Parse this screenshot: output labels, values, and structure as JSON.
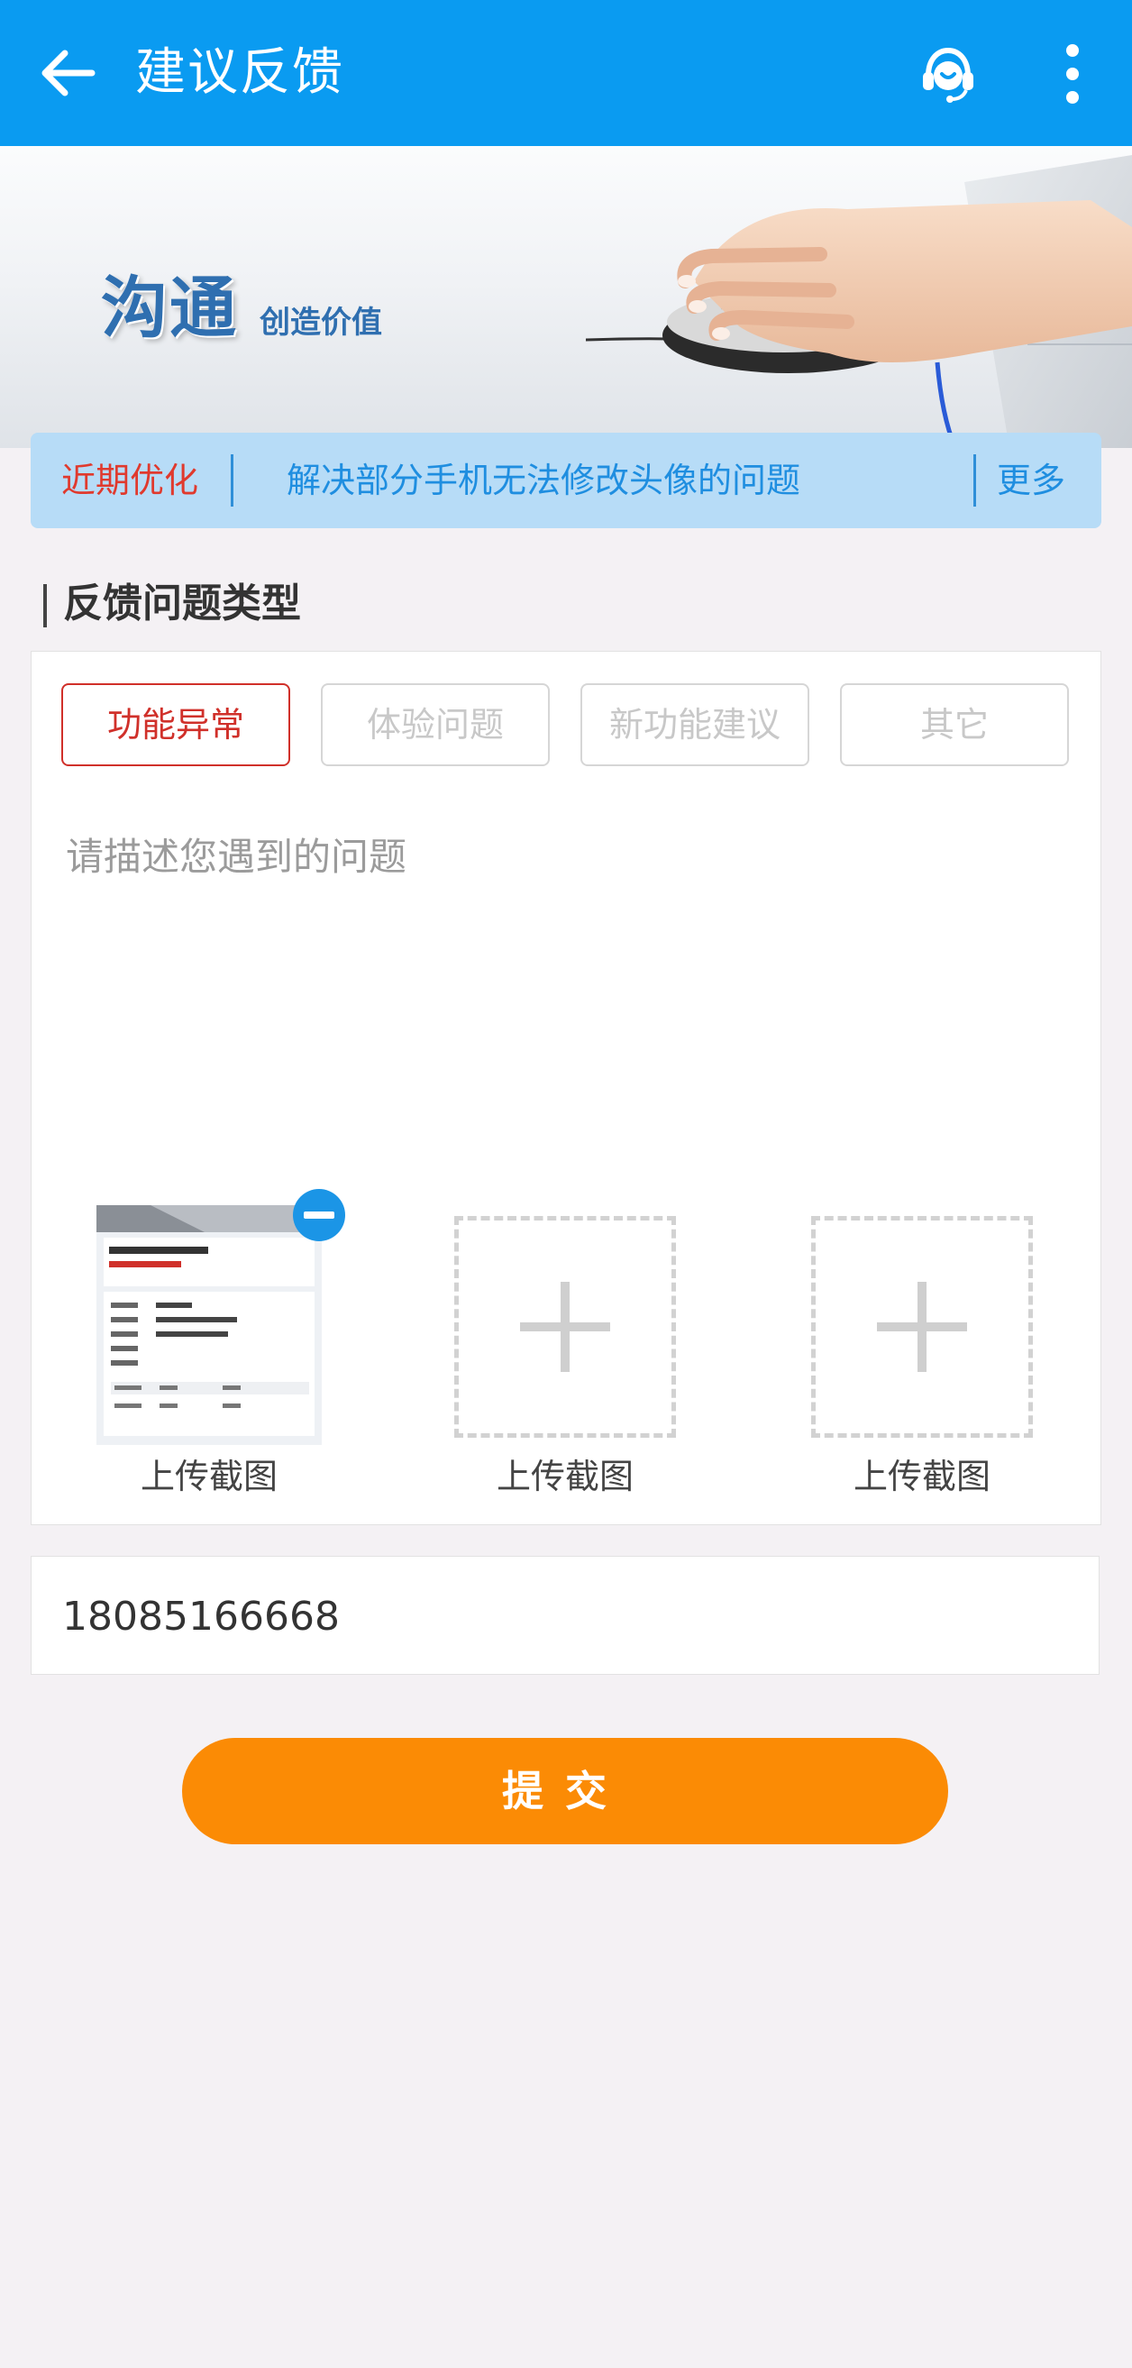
{
  "header": {
    "title": "建议反馈",
    "back_icon": "arrow-left-icon",
    "service_icon": "customer-service-headset-icon",
    "more_icon": "more-vertical-icon",
    "background_color": "#0a9bf1"
  },
  "banner": {
    "main_text": "沟通",
    "sub_text": "创造价值"
  },
  "notice": {
    "label": "近期优化",
    "text": "解决部分手机无法修改头像的问题",
    "more": "更多"
  },
  "feedback": {
    "section_title": "反馈问题类型",
    "types": [
      {
        "label": "功能异常",
        "selected": true
      },
      {
        "label": "体验问题",
        "selected": false
      },
      {
        "label": "新功能建议",
        "selected": false
      },
      {
        "label": "其它",
        "selected": false
      }
    ],
    "description_placeholder": "请描述您遇到的问题",
    "uploads": [
      {
        "label": "上传截图",
        "has_image": true
      },
      {
        "label": "上传截图",
        "has_image": false
      },
      {
        "label": "上传截图",
        "has_image": false
      }
    ]
  },
  "contact": {
    "phone": "18085166668"
  },
  "submit": {
    "label": "提交",
    "color": "#fb8b05"
  },
  "colors": {
    "accent_red": "#d0302a",
    "link_blue": "#1f8ee0",
    "notice_bg": "#b7dcf7"
  }
}
